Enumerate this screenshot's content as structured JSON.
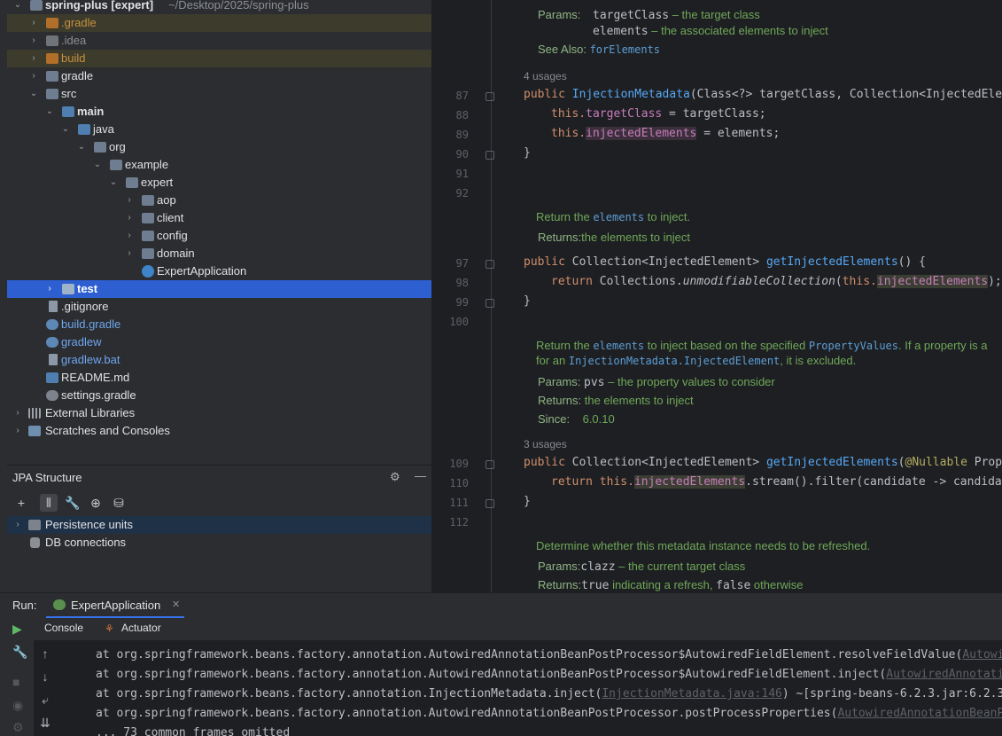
{
  "project_tree": {
    "items": [
      {
        "label": "spring-plus [expert]",
        "extra": "~/Desktop/2025/spring-plus",
        "icon": "project-folder-icon"
      },
      {
        "label": ".gradle",
        "icon": "folder-icon"
      },
      {
        "label": ".idea",
        "icon": "folder-icon"
      },
      {
        "label": "build",
        "icon": "folder-icon"
      },
      {
        "label": "gradle",
        "icon": "folder-icon"
      },
      {
        "label": "src",
        "icon": "folder-icon"
      },
      {
        "label": "main",
        "icon": "folder-icon"
      },
      {
        "label": "java",
        "icon": "source-folder-icon"
      },
      {
        "label": "org",
        "icon": "package-icon"
      },
      {
        "label": "example",
        "icon": "package-icon"
      },
      {
        "label": "expert",
        "icon": "package-icon"
      },
      {
        "label": "aop",
        "icon": "package-icon"
      },
      {
        "label": "client",
        "icon": "package-icon"
      },
      {
        "label": "config",
        "icon": "package-icon"
      },
      {
        "label": "domain",
        "icon": "package-icon"
      },
      {
        "label": "ExpertApplication",
        "icon": "spring-class-icon"
      },
      {
        "label": "test",
        "icon": "folder-icon"
      },
      {
        "label": ".gitignore",
        "icon": "file-icon"
      },
      {
        "label": "build.gradle",
        "icon": "gradle-icon"
      },
      {
        "label": "gradlew",
        "icon": "gradle-icon"
      },
      {
        "label": "gradlew.bat",
        "icon": "file-icon"
      },
      {
        "label": "README.md",
        "icon": "markdown-icon"
      },
      {
        "label": "settings.gradle",
        "icon": "gradle-icon"
      },
      {
        "label": "External Libraries",
        "icon": "library-icon"
      },
      {
        "label": "Scratches and Consoles",
        "icon": "scratches-icon"
      }
    ]
  },
  "jpa": {
    "title": "JPA Structure",
    "items": [
      "Persistence units",
      "DB connections"
    ]
  },
  "editor": {
    "doc1": {
      "params_label": "Params:",
      "p1_name": "targetClass",
      "p1_desc": " – the target class",
      "p2_name": "elements",
      "p2_desc": " – the associated elements to inject",
      "see_also_label": "See Also:",
      "see_also_link": "forElements"
    },
    "usages1": "4 usages",
    "usages2": "3 usages",
    "line_numbers": [
      "87",
      "88",
      "89",
      "90",
      "91",
      "92",
      "97",
      "98",
      "99",
      "100",
      "109",
      "110",
      "111",
      "112"
    ],
    "code": {
      "l87_a": "public ",
      "l87_b": "InjectionMetadata",
      "l87_c": "(Class<?> targetClass, Collection<InjectedElem",
      "l88_a": "this.",
      "l88_b": "targetClass",
      "l88_c": " = targetClass;",
      "l89_a": "this.",
      "l89_b": "injectedElements",
      "l89_c": " = elements;",
      "l90": "}",
      "l97_a": "public ",
      "l97_b": "Collection<InjectedElement> ",
      "l97_c": "getInjectedElements",
      "l97_d": "() {",
      "l98_a": "return ",
      "l98_b": "Collections.",
      "l98_c": "unmodifiableCollection",
      "l98_d": "(",
      "l98_e": "this.",
      "l98_f": "injectedElements",
      "l98_g": ");",
      "l99": "}",
      "l109_a": "public ",
      "l109_b": "Collection<InjectedElement> ",
      "l109_c": "getInjectedElements",
      "l109_d": "(",
      "l109_e": "@Nullable",
      "l109_f": " Prope",
      "l110_a": "return ",
      "l110_b": "this.",
      "l110_c": "injectedElements",
      "l110_d": ".stream().filter(candidate -> candidat",
      "l111": "}"
    },
    "doc2": {
      "line1_a": "Return the ",
      "line1_b": "elements",
      "line1_c": " to inject.",
      "returns_label": "Returns:",
      "returns_text": "the elements to inject"
    },
    "doc3": {
      "line1_a": "Return the ",
      "line1_b": "elements",
      "line1_c": " to inject based on the specified ",
      "line1_d": "PropertyValues",
      "line1_e": ". If a property is a",
      "line2_a": "for an ",
      "line2_b": "InjectionMetadata.InjectedElement",
      "line2_c": ", it is excluded.",
      "params_label": "Params:",
      "p_name": "pvs",
      "p_desc": " – the property values to consider",
      "returns_label": "Returns:",
      "returns_text": " the elements to inject",
      "since_label": "Since:",
      "since_text": "6.0.10"
    },
    "doc4": {
      "line1": "Determine whether this metadata instance needs to be refreshed.",
      "params_label": "Params:",
      "p_name": "clazz",
      "p_desc": " – the current target class",
      "returns_label": "Returns:",
      "returns_a": "true",
      "returns_b": " indicating a refresh, ",
      "returns_c": "false",
      "returns_d": " otherwise"
    }
  },
  "run": {
    "label": "Run:",
    "tab": "ExpertApplication",
    "console_tab": "Console",
    "actuator_tab": "Actuator",
    "lines": [
      {
        "a": "at org.springframework.beans.factory.annotation.AutowiredAnnotationBeanPostProcessor$AutowiredFieldElement.resolveFieldValue(",
        "b": "Autowi"
      },
      {
        "a": "at org.springframework.beans.factory.annotation.AutowiredAnnotationBeanPostProcessor$AutowiredFieldElement.inject(",
        "b": "AutowiredAnnotati"
      },
      {
        "a": "at org.springframework.beans.factory.annotation.InjectionMetadata.inject(",
        "b": "InjectionMetadata.java:146",
        "c": ") ~[spring-beans-6.2.3.jar:6.2.3"
      },
      {
        "a": "at org.springframework.beans.factory.annotation.AutowiredAnnotationBeanPostProcessor.postProcessProperties(",
        "b": "AutowiredAnnotationBeanP"
      },
      {
        "a": "... 73 common frames omitted"
      }
    ]
  },
  "colors": {
    "selection": "#2e5fd0",
    "background": "#2b2d30",
    "editor_bg": "#1e1f22",
    "doc_green": "#6fa859"
  }
}
